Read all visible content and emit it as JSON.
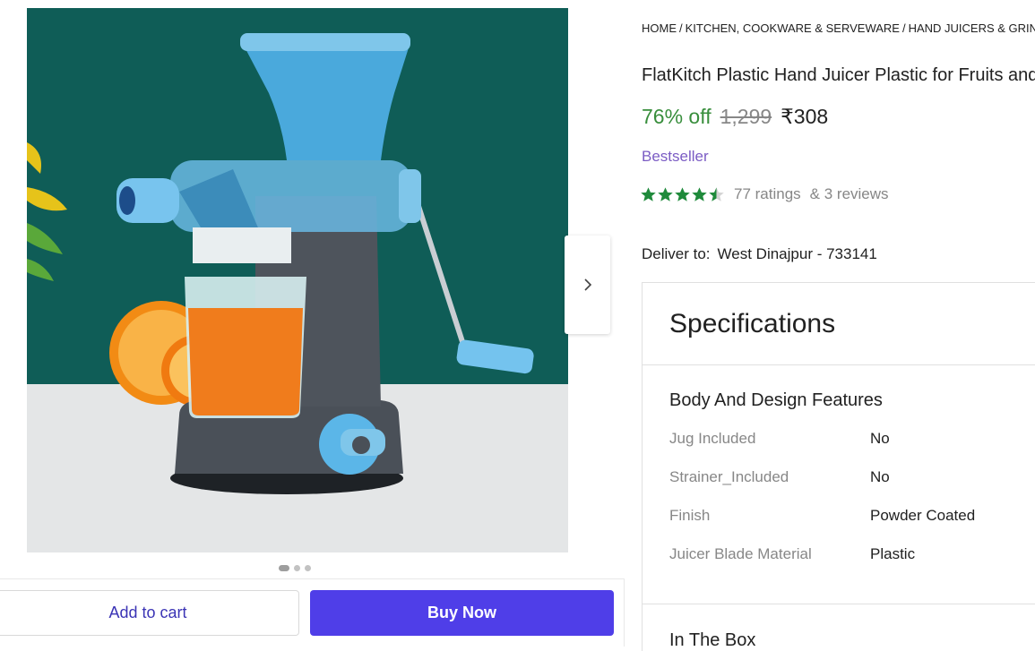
{
  "breadcrumb": [
    "HOME",
    "KITCHEN, COOKWARE & SERVEWARE",
    "HAND JUICERS & GRINDERS"
  ],
  "product": {
    "title": "FlatKitch Plastic Hand Juicer Plastic for Fruits and Vegetables",
    "discount": "76% off",
    "mrp": "1,299",
    "price": "₹308",
    "badge": "Bestseller",
    "rating_stars": 4.5,
    "ratings_text": "77 ratings",
    "reviews_text": "& 3 reviews"
  },
  "delivery": {
    "label": "Deliver to:",
    "location": "West Dinajpur - 733141"
  },
  "gallery": {
    "image_count": 3,
    "active_index": 0
  },
  "actions": {
    "add_to_cart": "Add to cart",
    "buy_now": "Buy Now"
  },
  "specifications": {
    "heading": "Specifications",
    "group_title": "Body And Design Features",
    "rows": [
      {
        "key": "Jug Included",
        "value": "No"
      },
      {
        "key": "Strainer_Included",
        "value": "No"
      },
      {
        "key": "Finish",
        "value": "Powder Coated"
      },
      {
        "key": "Juicer Blade Material",
        "value": "Plastic"
      }
    ],
    "next_section": "In The Box"
  },
  "colors": {
    "discount_green": "#388e3c",
    "badge_purple": "#7b5cc4",
    "buy_button": "#4f3ee8",
    "star_green": "#1f8a3b"
  },
  "icons": [
    "chevron-right-icon",
    "star-icon"
  ]
}
